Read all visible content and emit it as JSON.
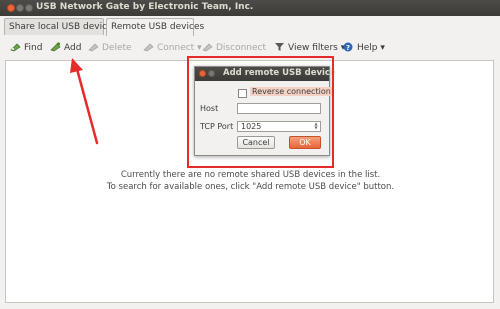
{
  "window": {
    "title": "USB Network Gate by Electronic Team, Inc."
  },
  "tabs": [
    {
      "label": "Share local USB devices",
      "active": false
    },
    {
      "label": "Remote USB devices",
      "active": true
    }
  ],
  "toolbar": {
    "find": "Find",
    "add": "Add",
    "delete": "Delete",
    "connect": "Connect",
    "disconnect": "Disconnect",
    "view_filters": "View filters",
    "help": "Help"
  },
  "content": {
    "line1": "Currently there are no remote shared USB devices in the list.",
    "line2": "To search for available ones, click \"Add remote USB device\" button."
  },
  "dialog": {
    "title": "Add remote USB device",
    "reverse_connection": "Reverse connection",
    "host_label": "Host",
    "host_value": "",
    "port_label": "TCP Port",
    "port_value": "1025",
    "cancel": "Cancel",
    "ok": "OK"
  },
  "colors": {
    "annotation": "#e62b2b",
    "ok_button": "#e8663a",
    "titlebar": "#3c3b37"
  }
}
